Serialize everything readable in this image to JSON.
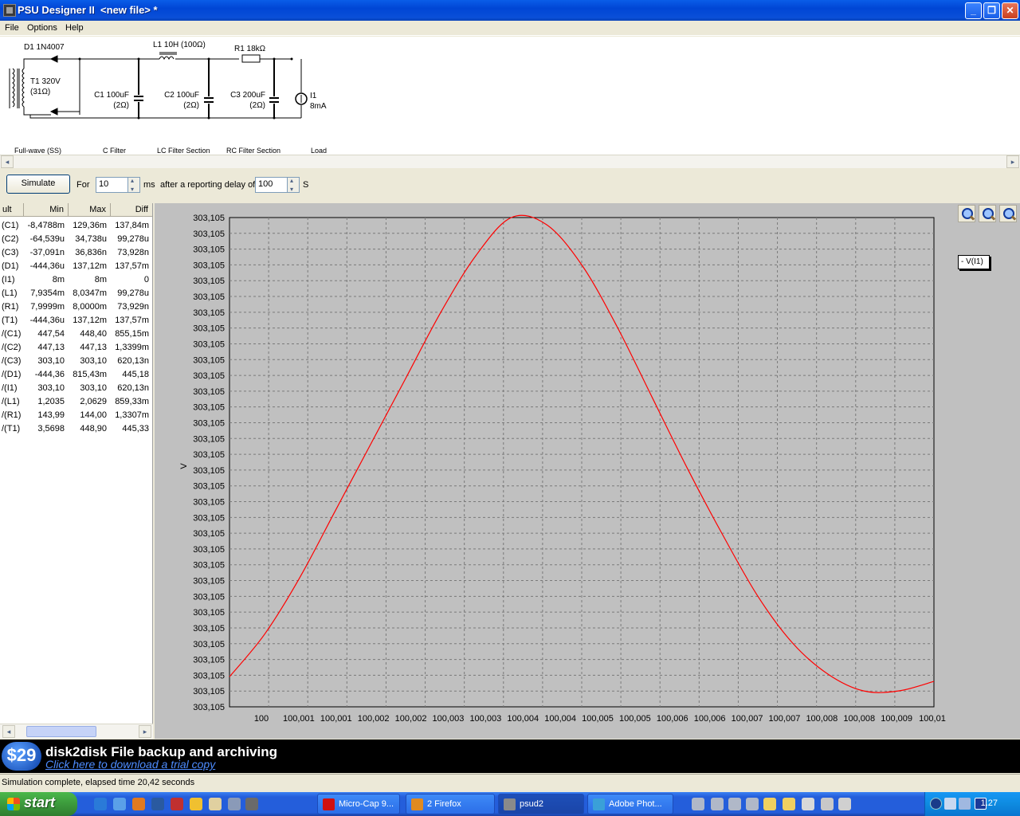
{
  "window": {
    "title": "PSU Designer II  <new file> *",
    "minimize": "_",
    "maximize": "❐",
    "close": "✕"
  },
  "menu": [
    "File",
    "Options",
    "Help"
  ],
  "schematic": {
    "components": {
      "d1": "D1 1N4007",
      "l1": "L1 10H (100Ω)",
      "r1": "R1 18kΩ",
      "t1_line1": "T1 320V",
      "t1_line2": "(31Ω)",
      "c1_line1": "C1 100uF",
      "c1_line2": "(2Ω)",
      "c2_line1": "C2 100uF",
      "c2_line2": "(2Ω)",
      "c3_line1": "C3 200uF",
      "c3_line2": "(2Ω)",
      "i1_line1": "I1",
      "i1_line2": "8mA"
    },
    "sections": [
      "Full-wave (SS)",
      "C Filter",
      "LC Filter Section",
      "RC Filter Section",
      "Load"
    ]
  },
  "simulation": {
    "button": "Simulate",
    "for_label": "For",
    "duration": "10",
    "duration_unit": "ms",
    "delay_label": "after a reporting delay of",
    "delay": "100",
    "delay_unit": "S"
  },
  "results": {
    "headers": [
      "ult",
      "Min",
      "Max",
      "Diff"
    ],
    "rows": [
      [
        "(C1)",
        "-8,4788m",
        "129,36m",
        "137,84m"
      ],
      [
        "(C2)",
        "-64,539u",
        "34,738u",
        "99,278u"
      ],
      [
        "(C3)",
        "-37,091n",
        "36,836n",
        "73,928n"
      ],
      [
        "(D1)",
        "-444,36u",
        "137,12m",
        "137,57m"
      ],
      [
        "(I1)",
        "8m",
        "8m",
        "0"
      ],
      [
        "(L1)",
        "7,9354m",
        "8,0347m",
        "99,278u"
      ],
      [
        "(R1)",
        "7,9999m",
        "8,0000m",
        "73,929n"
      ],
      [
        "(T1)",
        "-444,36u",
        "137,12m",
        "137,57m"
      ],
      [
        "/(C1)",
        "447,54",
        "448,40",
        "855,15m"
      ],
      [
        "/(C2)",
        "447,13",
        "447,13",
        "1,3399m"
      ],
      [
        "/(C3)",
        "303,10",
        "303,10",
        "620,13n"
      ],
      [
        "/(D1)",
        "-444,36",
        "815,43m",
        "445,18"
      ],
      [
        "/(I1)",
        "303,10",
        "303,10",
        "620,13n"
      ],
      [
        "/(L1)",
        "1,2035",
        "2,0629",
        "859,33m"
      ],
      [
        "/(R1)",
        "143,99",
        "144,00",
        "1,3307m"
      ],
      [
        "/(T1)",
        "3,5698",
        "448,90",
        "445,33"
      ]
    ]
  },
  "chart_data": {
    "type": "line",
    "ylabel": "V",
    "y_tick_labels": [
      "303,105",
      "303,105",
      "303,105",
      "303,105",
      "303,105",
      "303,105",
      "303,105",
      "303,105",
      "303,105",
      "303,105",
      "303,105",
      "303,105",
      "303,105",
      "303,105",
      "303,105",
      "303,105",
      "303,105",
      "303,105",
      "303,105",
      "303,105",
      "303,105",
      "303,105",
      "303,105",
      "303,105",
      "303,105",
      "303,105",
      "303,105",
      "303,105",
      "303,105",
      "303,105",
      "303,105",
      "303,105"
    ],
    "x_tick_labels": [
      "100",
      "100,001",
      "100,001",
      "100,002",
      "100,002",
      "100,003",
      "100,003",
      "100,004",
      "100,004",
      "100,005",
      "100,005",
      "100,006",
      "100,006",
      "100,007",
      "100,007",
      "100,008",
      "100,008",
      "100,009",
      "100,01"
    ],
    "xlim": [
      100,
      100.01
    ],
    "grid": true,
    "legend": "top-right",
    "series": [
      {
        "name": "V(I1)",
        "color": "#ff0000",
        "x": [
          100,
          100.0005,
          100.001,
          100.0015,
          100.002,
          100.0025,
          100.003,
          100.0035,
          100.004,
          100.0045,
          100.005,
          100.0055,
          100.006,
          100.0065,
          100.007,
          100.0075,
          100.008,
          100.0085,
          100.009,
          100.0095,
          100.01
        ],
        "y": [
          0.03,
          0.12,
          0.24,
          0.38,
          0.52,
          0.66,
          0.8,
          0.92,
          1.0,
          0.985,
          0.9,
          0.77,
          0.62,
          0.47,
          0.33,
          0.2,
          0.1,
          0.035,
          0.0,
          0.0,
          0.02
        ]
      }
    ],
    "y_unit_note": ""
  },
  "ad": {
    "price": "$29",
    "title": "disk2disk File backup and archiving",
    "link": "Click here to download a trial copy"
  },
  "status": "Simulation complete, elapsed time 20,42 seconds",
  "taskbar": {
    "start": "start",
    "tasks": [
      {
        "label": "Micro-Cap 9...",
        "color": "#d01010"
      },
      {
        "label": "2 Firefox",
        "color": "#e08a20"
      },
      {
        "label": "psud2",
        "color": "#707070"
      },
      {
        "label": "Adobe Phot...",
        "color": "#3aa0d8"
      }
    ],
    "clock": "1.27"
  }
}
